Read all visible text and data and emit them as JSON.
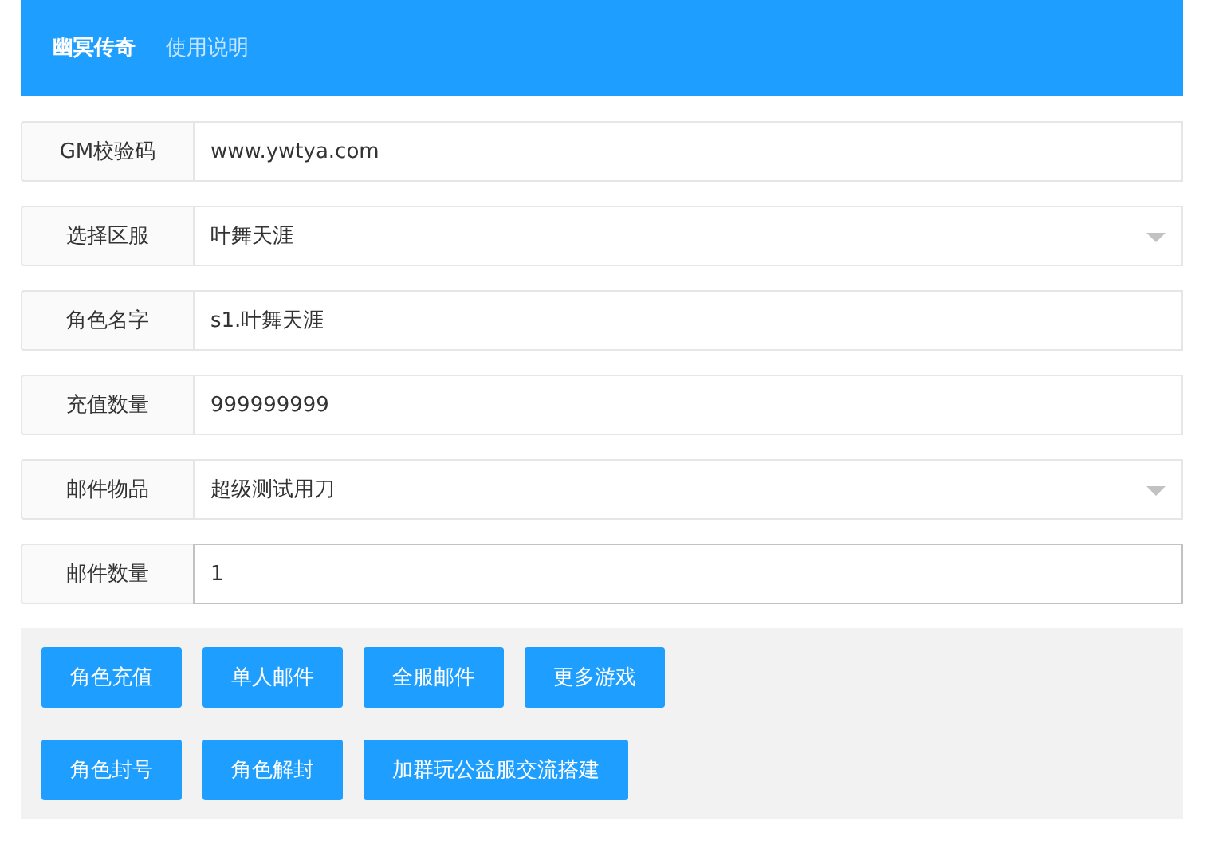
{
  "header": {
    "nav": [
      {
        "label": "幽冥传奇",
        "selected": true
      },
      {
        "label": "使用说明",
        "selected": false
      }
    ]
  },
  "fields": [
    {
      "label": "GM校验码",
      "kind": "text",
      "value": "www.ywtya.com",
      "focused": false
    },
    {
      "label": "选择区服",
      "kind": "select",
      "value": "叶舞天涯",
      "focused": false
    },
    {
      "label": "角色名字",
      "kind": "text",
      "value": "s1.叶舞天涯",
      "focused": false
    },
    {
      "label": "充值数量",
      "kind": "text",
      "value": "999999999",
      "focused": false
    },
    {
      "label": "邮件物品",
      "kind": "select",
      "value": "超级测试用刀",
      "focused": false
    },
    {
      "label": "邮件数量",
      "kind": "text",
      "value": "1",
      "focused": true
    }
  ],
  "button_rows": [
    [
      "角色充值",
      "单人邮件",
      "全服邮件",
      "更多游戏"
    ],
    [
      "角色封号",
      "角色解封",
      "加群玩公益服交流搭建"
    ]
  ]
}
